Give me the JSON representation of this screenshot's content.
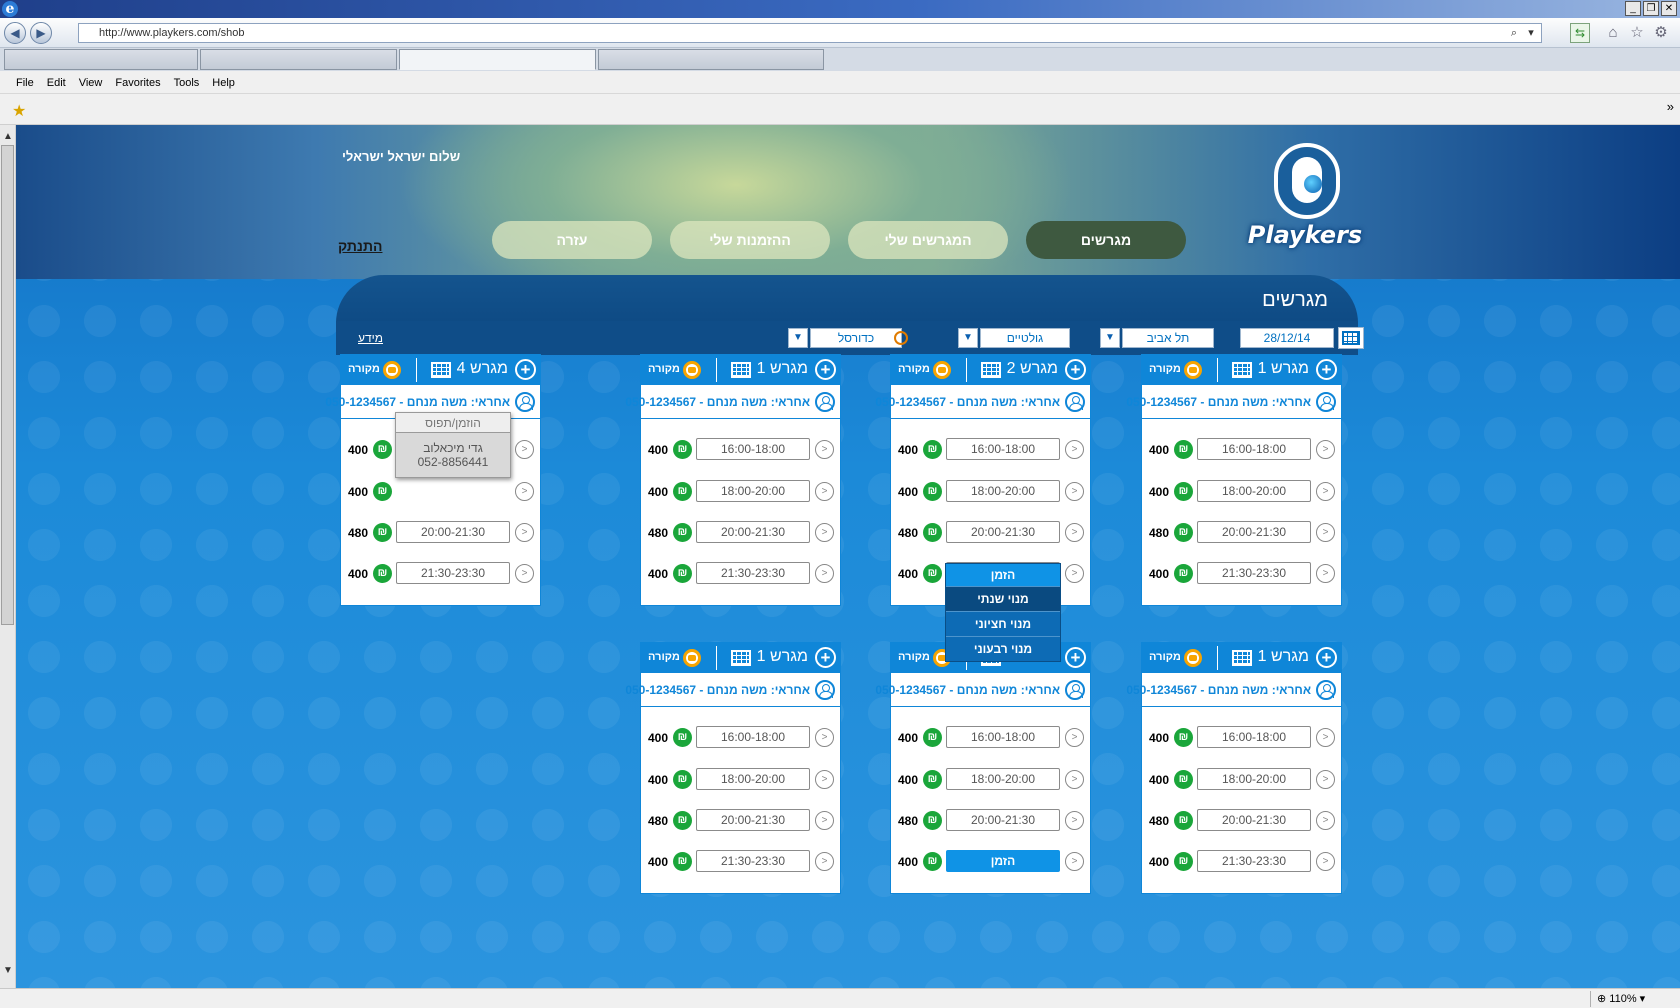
{
  "browser": {
    "url": "http://www.playkers.com/shob",
    "menu": [
      "File",
      "Edit",
      "View",
      "Favorites",
      "Tools",
      "Help"
    ],
    "zoom": "110%"
  },
  "site": {
    "logo_text": "Playkers",
    "greeting": "שלום ישראל ישראלי",
    "logout": "התנתק",
    "nav": [
      "מגרשים",
      "המגרשים שלי",
      "ההזמנות שלי",
      "עזרה"
    ],
    "nav_active": 0
  },
  "panel": {
    "title": "מגרשים",
    "info_link": "מידע",
    "filters": {
      "date": "28/12/14",
      "city": "תל אביב",
      "type": "גולטיים",
      "sport": "כדורסל"
    }
  },
  "cards": [
    {
      "name": "מגרש 1",
      "covered": "מקורה",
      "manager": "אחראי: משה מנחם - 050-1234567",
      "rows": [
        {
          "price": "400",
          "slot": "16:00-18:00"
        },
        {
          "price": "400",
          "slot": "18:00-20:00"
        },
        {
          "price": "480",
          "slot": "20:00-21:30"
        },
        {
          "price": "400",
          "slot": "21:30-23:30"
        }
      ]
    },
    {
      "name": "מגרש 2",
      "covered": "מקורה",
      "manager": "אחראי: משה מנחם - 050-1234567",
      "rows": [
        {
          "price": "400",
          "slot": "16:00-18:00"
        },
        {
          "price": "400",
          "slot": "18:00-20:00"
        },
        {
          "price": "480",
          "slot": "20:00-21:30"
        },
        {
          "price": "400",
          "slot": "21:30-23:30"
        }
      ]
    },
    {
      "name": "מגרש 1",
      "covered": "מקורה",
      "manager": "אחראי: משה מנחם - 050-1234567",
      "rows": [
        {
          "price": "400",
          "slot": "16:00-18:00"
        },
        {
          "price": "400",
          "slot": "18:00-20:00"
        },
        {
          "price": "480",
          "slot": "20:00-21:30"
        },
        {
          "price": "400",
          "slot": "21:30-23:30"
        }
      ]
    },
    {
      "name": "מגרש 4",
      "covered": "מקורה",
      "manager": "אחראי: משה מנחם - 050-1234567",
      "rows": [
        {
          "price": "400",
          "slot": ""
        },
        {
          "price": "400",
          "slot": ""
        },
        {
          "price": "480",
          "slot": "20:00-21:30"
        },
        {
          "price": "400",
          "slot": "21:30-23:30"
        }
      ]
    },
    {
      "name": "מגרש 1",
      "covered": "מקורה",
      "manager": "אחראי: משה מנחם - 050-1234567",
      "rows": [
        {
          "price": "400",
          "slot": "16:00-18:00"
        },
        {
          "price": "400",
          "slot": "18:00-20:00"
        },
        {
          "price": "480",
          "slot": "20:00-21:30"
        },
        {
          "price": "400",
          "slot": "21:30-23:30"
        }
      ]
    },
    {
      "name": "",
      "covered": "מקורה",
      "manager": "אחראי: משה מנחם - 050-1234567",
      "rows": [
        {
          "price": "400",
          "slot": "16:00-18:00"
        },
        {
          "price": "400",
          "slot": "18:00-20:00"
        },
        {
          "price": "480",
          "slot": "20:00-21:30"
        },
        {
          "price": "400",
          "slot": "הזמן"
        }
      ]
    },
    {
      "name": "מגרש 1",
      "covered": "מקורה",
      "manager": "אחראי: משה מנחם - 050-1234567",
      "rows": [
        {
          "price": "400",
          "slot": "16:00-18:00"
        },
        {
          "price": "400",
          "slot": "18:00-20:00"
        },
        {
          "price": "480",
          "slot": "20:00-21:30"
        },
        {
          "price": "400",
          "slot": "21:30-23:30"
        }
      ]
    }
  ],
  "busy_popup": {
    "title": "הוזמן/תפוס",
    "name": "גדי מיכאלוב",
    "phone": "052-8856441"
  },
  "book_menu": {
    "title": "הזמן",
    "items": [
      "מנוי שנתי",
      "מנוי חציוני",
      "מנוי רבעוני"
    ],
    "selected": 0
  }
}
